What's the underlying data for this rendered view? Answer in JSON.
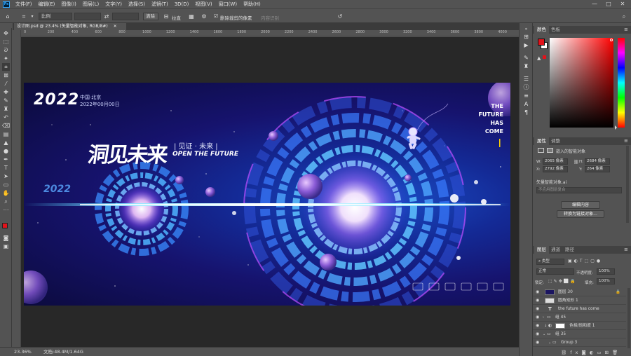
{
  "menu": {
    "app_icon": "Ps",
    "items": [
      "文件(F)",
      "编辑(E)",
      "图像(I)",
      "图层(L)",
      "文字(Y)",
      "选择(S)",
      "滤镜(T)",
      "3D(D)",
      "视图(V)",
      "窗口(W)",
      "帮助(H)"
    ],
    "window_controls": [
      "—",
      "□",
      "✕"
    ]
  },
  "options": {
    "ratio_value": "比例",
    "clear_label": "清除",
    "straighten_label": "拉直",
    "delete_cropped_label": "删除裁剪的像素",
    "content_aware_label": "内容识别"
  },
  "document": {
    "tab_title": "设计图.psd @ 23.4% (矢量智能对象, RGB/8#)",
    "tab_close": "✕",
    "ruler_ticks": [
      "0",
      "200",
      "400",
      "600",
      "800",
      "1000",
      "1200",
      "1400",
      "1600",
      "1800",
      "2000",
      "2200",
      "2400",
      "2600",
      "2800",
      "3000",
      "3200",
      "3400",
      "3600",
      "3800",
      "4000"
    ]
  },
  "artwork": {
    "year": "2022",
    "location": "中国·北京",
    "date": "2022年00月00日",
    "title_cn": "洞见未来",
    "subtitle_cn": "| 见证 · 未来 |",
    "subtitle_en": "OPEN THE FUTURE",
    "future_lines": [
      "THE",
      "FUTURE",
      "HAS",
      "COME"
    ],
    "small_logo_year": "2022"
  },
  "status": {
    "zoom": "23.36%",
    "doc_size": "文档:48.4M/1.64G"
  },
  "color_panel": {
    "tabs": [
      "颜色",
      "色板"
    ],
    "fg_color": "#e2131b",
    "bg_color": "#ffffff",
    "picker_hue": "#ff0000"
  },
  "properties_panel": {
    "tabs": [
      "属性",
      "调整"
    ],
    "object_type": "嵌入的智能对象",
    "w_label": "W:",
    "w_value": "2065 像素",
    "h_label": "H:",
    "h_value": "2684 像素",
    "x_label": "X:",
    "x_value": "2792 像素",
    "y_label": "Y:",
    "y_value": "264 像素",
    "file_name": "矢量智能对象.ai",
    "comp_placeholder": "不应用图层复合",
    "edit_button": "编辑内容",
    "convert_button": "转换为链接对象..."
  },
  "layers_panel": {
    "tabs": [
      "图层",
      "通道",
      "路径"
    ],
    "filter_kind": "类型",
    "blend_mode": "正常",
    "opacity_label": "不透明度:",
    "opacity_value": "100%",
    "lock_label": "锁定:",
    "fill_label": "填充:",
    "fill_value": "100%",
    "layers": [
      {
        "name": "图层 30",
        "type": "image"
      },
      {
        "name": "圆角矩形 1",
        "type": "shape"
      },
      {
        "name": "the future has come",
        "type": "text"
      },
      {
        "name": "组 45",
        "type": "group"
      },
      {
        "name": "色相/饱和度 1",
        "type": "adjustment"
      },
      {
        "name": "组 35",
        "type": "group"
      },
      {
        "name": "Group 3",
        "type": "group"
      }
    ]
  },
  "colors": {
    "ui_bg": "#535353",
    "ui_dark": "#3b3b3b",
    "accent_blue": "#31a8ff",
    "bg_primary": "#0b0a3a"
  }
}
